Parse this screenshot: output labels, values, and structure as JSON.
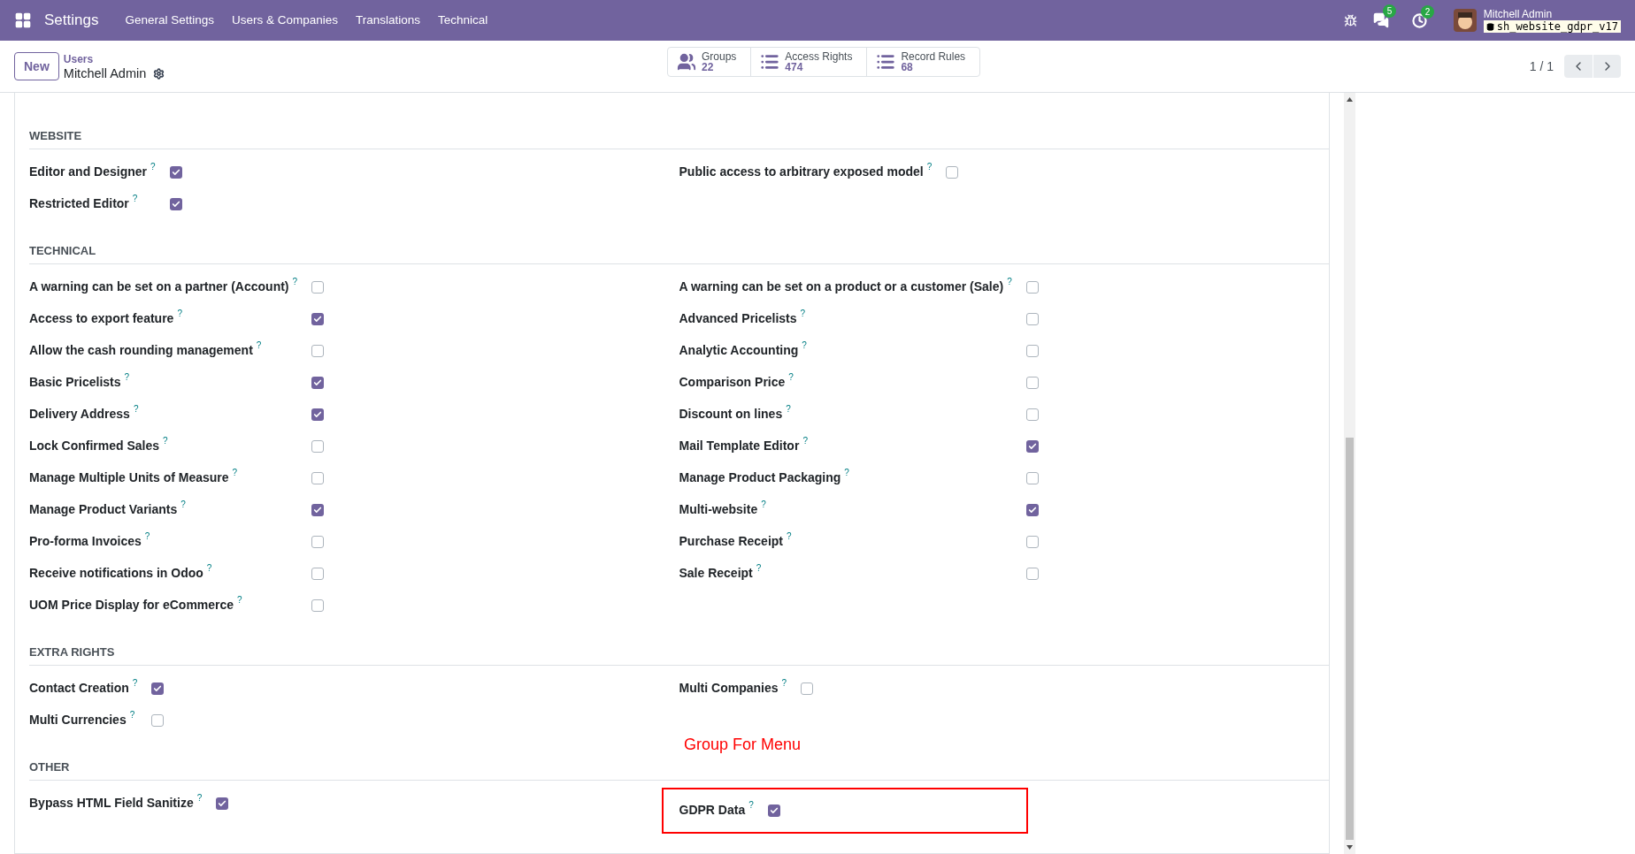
{
  "navbar": {
    "app_title": "Settings",
    "menu": [
      "General Settings",
      "Users & Companies",
      "Translations",
      "Technical"
    ],
    "systray": {
      "messages_count": "5",
      "activities_count": "2",
      "user_name": "Mitchell Admin",
      "database": "sh_website_gdpr_v17"
    }
  },
  "control_panel": {
    "new_button": "New",
    "breadcrumb": "Users",
    "record_name": "Mitchell Admin",
    "smart_buttons": [
      {
        "kind": "groups",
        "label": "Groups",
        "count": "22"
      },
      {
        "kind": "list",
        "label": "Access Rights",
        "count": "474"
      },
      {
        "kind": "list",
        "label": "Record Rules",
        "count": "68"
      }
    ],
    "pager": "1 / 1"
  },
  "sections": [
    {
      "title": "WEBSITE",
      "left": [
        {
          "label": "Editor and Designer",
          "help": "?",
          "checked": true,
          "highlighted": false
        },
        {
          "label": "Restricted Editor",
          "help": "?",
          "checked": true,
          "highlighted": false
        }
      ],
      "right": [
        {
          "label": "Public access to arbitrary exposed model",
          "help": "?",
          "checked": false,
          "highlighted": false
        }
      ]
    },
    {
      "title": "TECHNICAL",
      "left": [
        {
          "label": "A warning can be set on a partner (Account)",
          "help": "?",
          "checked": false,
          "highlighted": false
        },
        {
          "label": "Access to export feature",
          "help": "?",
          "checked": true,
          "highlighted": false
        },
        {
          "label": "Allow the cash rounding management",
          "help": "?",
          "checked": false,
          "highlighted": false
        },
        {
          "label": "Basic Pricelists",
          "help": "?",
          "checked": true,
          "highlighted": false
        },
        {
          "label": "Delivery Address",
          "help": "?",
          "checked": true,
          "highlighted": false
        },
        {
          "label": "Lock Confirmed Sales",
          "help": "?",
          "checked": false,
          "highlighted": false
        },
        {
          "label": "Manage Multiple Units of Measure",
          "help": "?",
          "checked": false,
          "highlighted": false
        },
        {
          "label": "Manage Product Variants",
          "help": "?",
          "checked": true,
          "highlighted": false
        },
        {
          "label": "Pro-forma Invoices",
          "help": "?",
          "checked": false,
          "highlighted": false
        },
        {
          "label": "Receive notifications in Odoo",
          "help": "?",
          "checked": false,
          "highlighted": false
        },
        {
          "label": "UOM Price Display for eCommerce",
          "help": "?",
          "checked": false,
          "highlighted": false
        }
      ],
      "right": [
        {
          "label": "A warning can be set on a product or a customer (Sale)",
          "help": "?",
          "checked": false,
          "highlighted": false
        },
        {
          "label": "Advanced Pricelists",
          "help": "?",
          "checked": false,
          "highlighted": false
        },
        {
          "label": "Analytic Accounting",
          "help": "?",
          "checked": false,
          "highlighted": false
        },
        {
          "label": "Comparison Price",
          "help": "?",
          "checked": false,
          "highlighted": false
        },
        {
          "label": "Discount on lines",
          "help": "?",
          "checked": false,
          "highlighted": false
        },
        {
          "label": "Mail Template Editor",
          "help": "?",
          "checked": true,
          "highlighted": false
        },
        {
          "label": "Manage Product Packaging",
          "help": "?",
          "checked": false,
          "highlighted": false
        },
        {
          "label": "Multi-website",
          "help": "?",
          "checked": true,
          "highlighted": false
        },
        {
          "label": "Purchase Receipt",
          "help": "?",
          "checked": false,
          "highlighted": false
        },
        {
          "label": "Sale Receipt",
          "help": "?",
          "checked": false,
          "highlighted": false
        }
      ]
    },
    {
      "title": "EXTRA RIGHTS",
      "left": [
        {
          "label": "Contact Creation",
          "help": "?",
          "checked": true,
          "highlighted": false
        },
        {
          "label": "Multi Currencies",
          "help": "?",
          "checked": false,
          "highlighted": false
        }
      ],
      "right": [
        {
          "label": "Multi Companies",
          "help": "?",
          "checked": false,
          "highlighted": false
        }
      ]
    },
    {
      "title": "OTHER",
      "annotation": "Group For Menu",
      "left": [
        {
          "label": "Bypass HTML Field Sanitize",
          "help": "?",
          "checked": true,
          "highlighted": false
        }
      ],
      "right": [
        {
          "label": "GDPR Data",
          "help": "?",
          "checked": true,
          "highlighted": true
        }
      ]
    }
  ]
}
